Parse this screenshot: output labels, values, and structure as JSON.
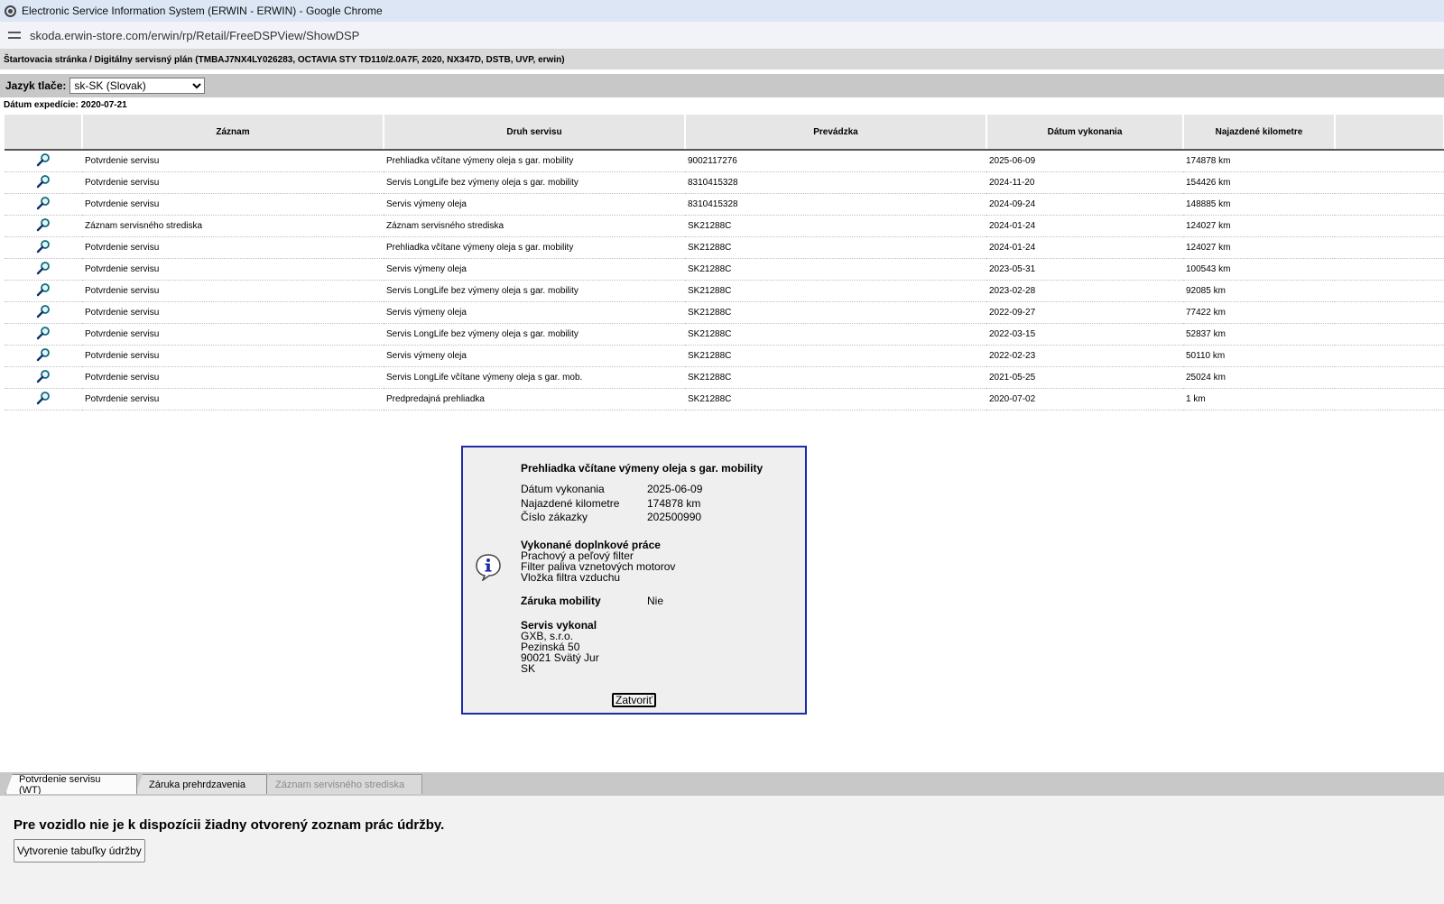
{
  "window": {
    "title": "Electronic Service Information System (ERWIN - ERWIN) - Google Chrome",
    "url": "skoda.erwin-store.com/erwin/rp/Retail/FreeDSPView/ShowDSP"
  },
  "breadcrumb": "Štartovacia stránka / Digitálny servisný plán (TMBAJ7NX4LY026283, OCTAVIA STY TD110/2.0A7F, 2020, NX347D, DSTB, UVP, erwin)",
  "print_language": {
    "label": "Jazyk tlače:",
    "selected": "sk-SK (Slovak)"
  },
  "expedition_date": "Dátum expedície: 2020-07-21",
  "table": {
    "headers": [
      "Záznam",
      "Druh servisu",
      "Prevádzka",
      "Dátum vykonania",
      "Najazdené kilometre"
    ],
    "rows": [
      [
        "Potvrdenie servisu",
        "Prehliadka včítane výmeny oleja s gar. mobility",
        "9002117276",
        "2025-06-09",
        "174878 km"
      ],
      [
        "Potvrdenie servisu",
        "Servis LongLife bez výmeny oleja s gar. mobility",
        "8310415328",
        "2024-11-20",
        "154426 km"
      ],
      [
        "Potvrdenie servisu",
        "Servis výmeny oleja",
        "8310415328",
        "2024-09-24",
        "148885 km"
      ],
      [
        "Záznam servisného strediska",
        "Záznam servisného strediska",
        "SK21288C",
        "2024-01-24",
        "124027 km"
      ],
      [
        "Potvrdenie servisu",
        "Prehliadka včítane výmeny oleja s gar. mobility",
        "SK21288C",
        "2024-01-24",
        "124027 km"
      ],
      [
        "Potvrdenie servisu",
        "Servis výmeny oleja",
        "SK21288C",
        "2023-05-31",
        "100543 km"
      ],
      [
        "Potvrdenie servisu",
        "Servis LongLife bez výmeny oleja s gar. mobility",
        "SK21288C",
        "2023-02-28",
        "92085 km"
      ],
      [
        "Potvrdenie servisu",
        "Servis výmeny oleja",
        "SK21288C",
        "2022-09-27",
        "77422 km"
      ],
      [
        "Potvrdenie servisu",
        "Servis LongLife bez výmeny oleja s gar. mobility",
        "SK21288C",
        "2022-03-15",
        "52837 km"
      ],
      [
        "Potvrdenie servisu",
        "Servis výmeny oleja",
        "SK21288C",
        "2022-02-23",
        "50110 km"
      ],
      [
        "Potvrdenie servisu",
        "Servis LongLife včítane výmeny oleja s gar. mob.",
        "SK21288C",
        "2021-05-25",
        "25024 km"
      ],
      [
        "Potvrdenie servisu",
        "Predpredajná prehliadka",
        "SK21288C",
        "2020-07-02",
        "1 km"
      ]
    ]
  },
  "dialog": {
    "title": "Prehliadka včítane výmeny oleja s gar. mobility",
    "date_label": "Dátum vykonania",
    "date_value": "2025-06-09",
    "km_label": "Najazdené kilometre",
    "km_value": "174878 km",
    "order_label": "Číslo zákazky",
    "order_value": "202500990",
    "extra_work_title": "Vykonané doplnkové práce",
    "extra_work": [
      "Prachový a peľový filter",
      "Filter paliva vznetových motorov",
      "Vložka filtra vzduchu"
    ],
    "mobility_label": "Záruka mobility",
    "mobility_value": "Nie",
    "performed_by_title": "Servis vykonal",
    "performed_by": [
      "GXB, s.r.o.",
      "Pezinská 50",
      "90021 Svätý Jur",
      "SK"
    ],
    "close_label": "Zatvoriť",
    "icon": "info-icon"
  },
  "tabs": [
    "Potvrdenie servisu (WT)",
    "Záruka prehrdzavenia",
    "Záznam servisného strediska"
  ],
  "bottom": {
    "message": "Pre vozidlo nie je k dispozícii žiadny otvorený zoznam prác údržby.",
    "button": "Vytvorenie tabuľky údržby"
  }
}
